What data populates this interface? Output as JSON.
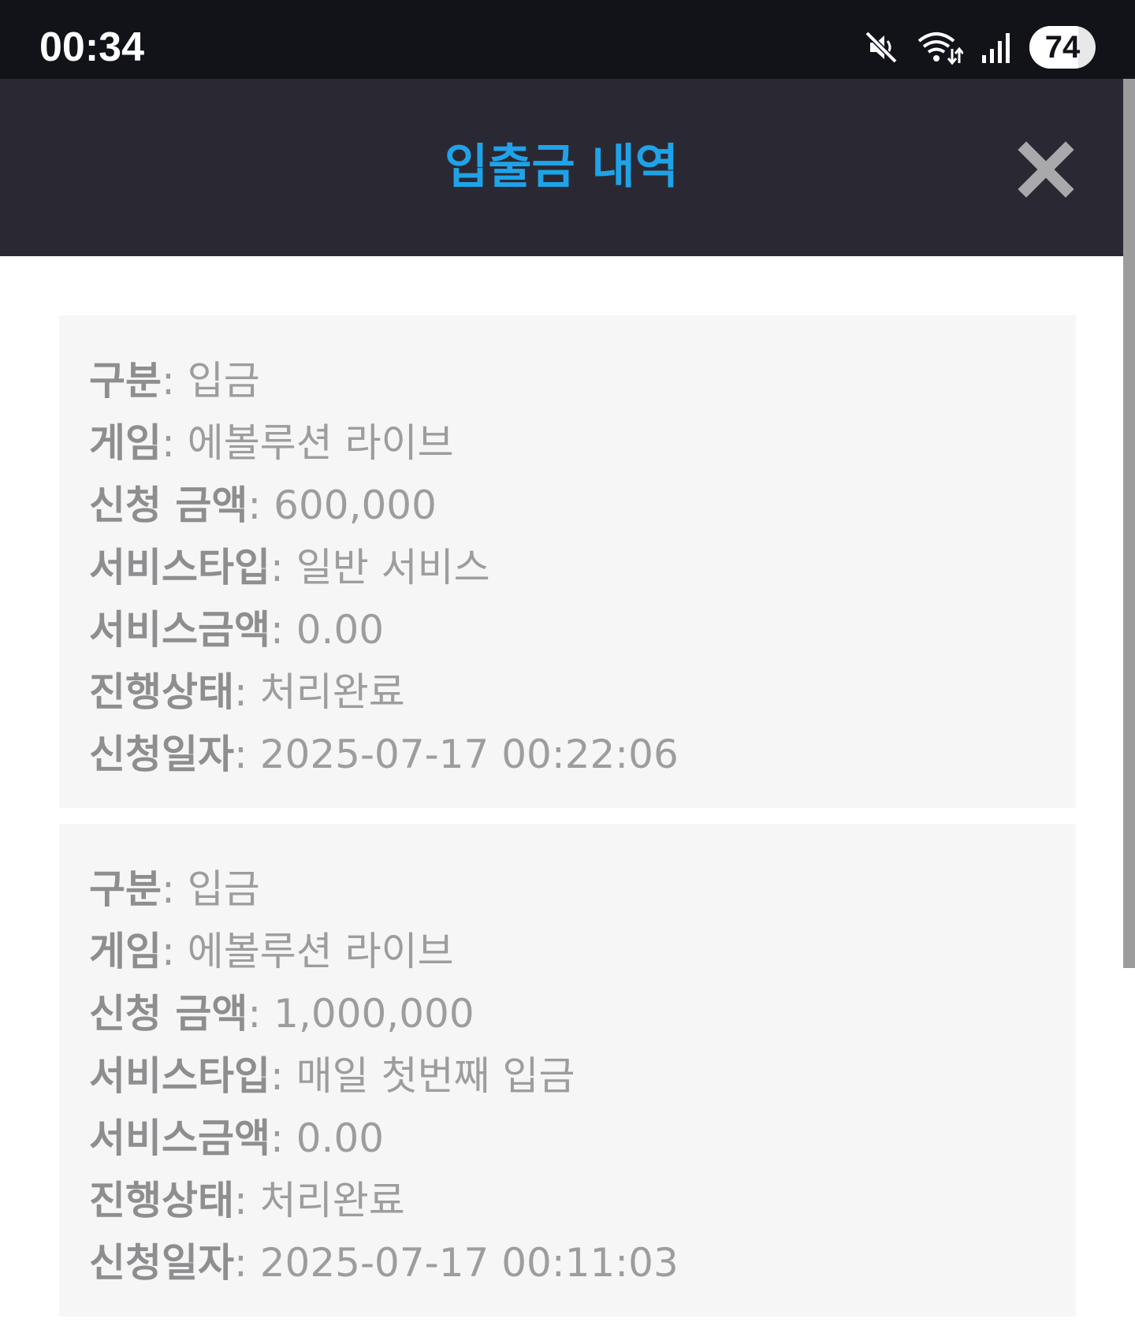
{
  "status_bar": {
    "time": "00:34",
    "battery_level": "74",
    "battery_fraction": 0.74,
    "icons": [
      "mute-icon",
      "wifi-icon",
      "signal-icon",
      "battery-icon"
    ]
  },
  "modal": {
    "title": "입출금 내역",
    "close_icon": "close-icon",
    "title_color": "#1fa3e8",
    "header_color": "#2a2933"
  },
  "records": [
    {
      "category_label": "구분",
      "category_value": "입금",
      "game_label": "게임",
      "game_value": "에볼루션 라이브",
      "amount_label": "신청 금액",
      "amount_value": "600,000",
      "service_type_label": "서비스타입",
      "service_type_value": "일반 서비스",
      "service_amount_label": "서비스금액",
      "service_amount_value": "0.00",
      "status_label": "진행상태",
      "status_value": "처리완료",
      "date_label": "신청일자",
      "date_value": "2025-07-17 00:22:06"
    },
    {
      "category_label": "구분",
      "category_value": "입금",
      "game_label": "게임",
      "game_value": "에볼루션 라이브",
      "amount_label": "신청 금액",
      "amount_value": "1,000,000",
      "service_type_label": "서비스타입",
      "service_type_value": "매일 첫번째 입금",
      "service_amount_label": "서비스금액",
      "service_amount_value": "0.00",
      "status_label": "진행상태",
      "status_value": "처리완료",
      "date_label": "신청일자",
      "date_value": "2025-07-17 00:11:03"
    }
  ]
}
